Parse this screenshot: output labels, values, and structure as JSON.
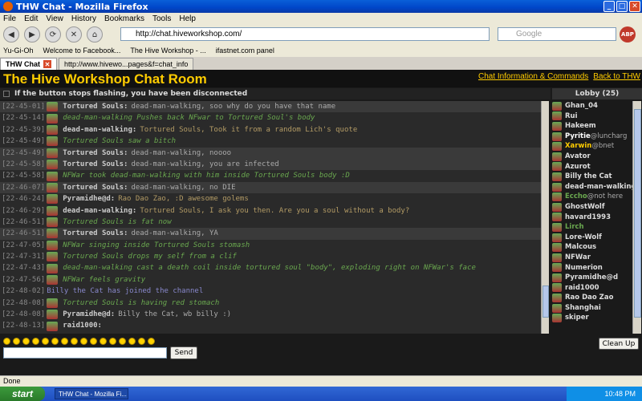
{
  "window": {
    "title": "THW Chat - Mozilla Firefox"
  },
  "menu": [
    "File",
    "Edit",
    "View",
    "History",
    "Bookmarks",
    "Tools",
    "Help"
  ],
  "nav": {
    "url": "http://chat.hiveworkshop.com/",
    "search_placeholder": "Google",
    "abp": "ABP"
  },
  "bookmarks": [
    "Yu-Gi-Oh",
    "Welcome to Facebook...",
    "The Hive Workshop - ...",
    "ifastnet.com panel"
  ],
  "tabs": [
    {
      "label": "THW Chat",
      "active": true
    },
    {
      "label": "http://www.hivewo...pages&f=chat_info",
      "active": false
    }
  ],
  "page": {
    "title": "The Hive Workshop Chat Room",
    "link_info": "Chat Information & Commands",
    "link_back": "Back to THW",
    "notice": "If the button stops flashing, you have been disconnected",
    "lobby_title": "Lobby (25)"
  },
  "messages": [
    {
      "ts": "[22-45-01]",
      "nick": "Tortured Souls:",
      "text": "dead-man-walking, soo why do you have that name",
      "kind": "normal",
      "alt": true
    },
    {
      "ts": "[22-45-14]",
      "nick": "",
      "text": "dead-man-walking Pushes back NFwar to Tortured Soul's body",
      "kind": "action",
      "alt": false
    },
    {
      "ts": "[22-45-39]",
      "nick": "dead-man-walking:",
      "text": "Tortured Souls, Took it from a random Lich's quote",
      "kind": "quote",
      "alt": false
    },
    {
      "ts": "[22-45-49]",
      "nick": "",
      "text": "Tortured Souls saw a bitch",
      "kind": "action",
      "alt": false
    },
    {
      "ts": "[22-45-49]",
      "nick": "Tortured Souls:",
      "text": "dead-man-walking, noooo",
      "kind": "normal",
      "alt": true
    },
    {
      "ts": "[22-45-58]",
      "nick": "Tortured Souls:",
      "text": "dead-man-walking, you are infected",
      "kind": "normal",
      "alt": true
    },
    {
      "ts": "[22-45-58]",
      "nick": "",
      "text": "NFWar took dead-man-walking with him inside Tortured Souls body :D",
      "kind": "action",
      "alt": false
    },
    {
      "ts": "[22-46-07]",
      "nick": "Tortured Souls:",
      "text": "dead-man-walking, no DIE",
      "kind": "normal",
      "alt": true
    },
    {
      "ts": "[22-46-24]",
      "nick": "Pyramidhe@d:",
      "text": "Rao Dao Zao, :D awesome golems",
      "kind": "quote",
      "alt": false
    },
    {
      "ts": "[22-46-29]",
      "nick": "dead-man-walking:",
      "text": "Tortured Souls, I ask you then. Are you a soul without a body?",
      "kind": "quote",
      "alt": false
    },
    {
      "ts": "[22-46-51]",
      "nick": "",
      "text": "Tortured Souls is fat now",
      "kind": "action",
      "alt": false
    },
    {
      "ts": "[22-46-51]",
      "nick": "Tortured Souls:",
      "text": "dead-man-walking, YA",
      "kind": "normal",
      "alt": true
    },
    {
      "ts": "[22-47-05]",
      "nick": "",
      "text": "NFWar singing inside Tortured Souls stomash",
      "kind": "action",
      "alt": false
    },
    {
      "ts": "[22-47-31]",
      "nick": "",
      "text": "Tortured Souls drops my self from a clif",
      "kind": "action",
      "alt": false
    },
    {
      "ts": "[22-47-43]",
      "nick": "",
      "text": "dead-man-walking cast a death coil inside tortured soul \"body\", exploding right on NFWar's face",
      "kind": "action",
      "alt": false
    },
    {
      "ts": "[22-47-56]",
      "nick": "",
      "text": "NFWar feels gravity",
      "kind": "action",
      "alt": false
    },
    {
      "ts": "[22-48-02]",
      "nick": "",
      "text": "Billy the Cat has joined the channel",
      "kind": "system",
      "alt": false
    },
    {
      "ts": "[22-48-08]",
      "nick": "",
      "text": "Tortured Souls is having red stomach",
      "kind": "action",
      "alt": false
    },
    {
      "ts": "[22-48-08]",
      "nick": "Pyramidhe@d:",
      "text": "Billy the Cat, wb billy :)",
      "kind": "normal",
      "alt": false
    },
    {
      "ts": "[22-48-13]",
      "nick": "raid1000:",
      "text": "",
      "kind": "normal",
      "alt": false
    }
  ],
  "lobby": [
    {
      "name": "Ghan_04",
      "suffix": "",
      "color": "#ddd"
    },
    {
      "name": "Rui",
      "suffix": "",
      "color": "#ddd"
    },
    {
      "name": "Hakeem",
      "suffix": "",
      "color": "#ddd"
    },
    {
      "name": "Pyritie",
      "suffix": "@luncharg",
      "color": "#fff"
    },
    {
      "name": "Xarwin",
      "suffix": "@bnet",
      "color": "#ffcc00"
    },
    {
      "name": "Avator",
      "suffix": "",
      "color": "#ddd"
    },
    {
      "name": "Azurot",
      "suffix": "",
      "color": "#ddd"
    },
    {
      "name": "Billy the Cat",
      "suffix": "",
      "color": "#ddd"
    },
    {
      "name": "dead-man-walking",
      "suffix": "",
      "color": "#ddd"
    },
    {
      "name": "Eccho",
      "suffix": "@not here",
      "color": "#6aa84f"
    },
    {
      "name": "GhostWolf",
      "suffix": "",
      "color": "#ddd"
    },
    {
      "name": "havard1993",
      "suffix": "",
      "color": "#ddd"
    },
    {
      "name": "Lirch",
      "suffix": "",
      "color": "#6aa84f"
    },
    {
      "name": "Lore-Wolf",
      "suffix": "",
      "color": "#ddd"
    },
    {
      "name": "Malcous",
      "suffix": "",
      "color": "#ddd"
    },
    {
      "name": "NFWar",
      "suffix": "",
      "color": "#ddd"
    },
    {
      "name": "Numerion",
      "suffix": "",
      "color": "#ddd"
    },
    {
      "name": "Pyramidhe@d",
      "suffix": "",
      "color": "#ddd"
    },
    {
      "name": "raid1000",
      "suffix": "",
      "color": "#ddd"
    },
    {
      "name": "Rao Dao Zao",
      "suffix": "",
      "color": "#ddd"
    },
    {
      "name": "Shanghai",
      "suffix": "",
      "color": "#ddd"
    },
    {
      "name": "skiper",
      "suffix": "",
      "color": "#ddd"
    }
  ],
  "controls": {
    "send": "Send",
    "clean": "Clean Up",
    "smiley_count": 16
  },
  "status": "Done",
  "taskbar": {
    "start": "start",
    "item": "THW Chat - Mozilla Fi...",
    "clock": "10:48 PM"
  }
}
